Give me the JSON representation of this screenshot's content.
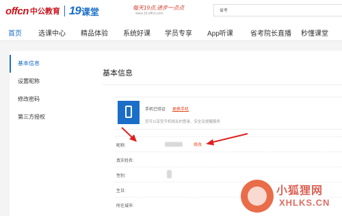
{
  "header": {
    "logo_offcn": "offcn",
    "logo_cn": "中公教育",
    "logo_19": "19",
    "logo_ke": "课堂",
    "slogan": "每天19点,进步一点点",
    "slogan_url": "www.19.offcn.com",
    "search_text": "省考"
  },
  "nav": {
    "items": [
      {
        "label": "首页",
        "active": true
      },
      {
        "label": "选课中心"
      },
      {
        "label": "精品体验"
      },
      {
        "label": "系统好课"
      },
      {
        "label": "学员专享"
      },
      {
        "label": "App听课"
      },
      {
        "label": "省考院长直播"
      },
      {
        "label": "秒懂课堂"
      }
    ]
  },
  "sidebar": {
    "items": [
      {
        "label": "基本信息",
        "active": true
      },
      {
        "label": "设置昵称"
      },
      {
        "label": "修改密码"
      },
      {
        "label": "第三方授权"
      }
    ]
  },
  "content": {
    "title": "基本信息",
    "phone": {
      "verified": "手机已验证",
      "change": "更换手机",
      "description": "您可以享受手机相关的登录、安全及提醒服务"
    },
    "fields": [
      {
        "label": "昵称:",
        "edit": "修改"
      },
      {
        "label": "真实姓名:"
      },
      {
        "label": "性别:"
      },
      {
        "label": "生日:"
      },
      {
        "label": "所在城市:"
      }
    ]
  },
  "watermark": {
    "cn": "小狐狸网",
    "en": "XHLKS.CN"
  },
  "colors": {
    "accent": "#1a6ec8",
    "brand_red": "#c8161d",
    "link_orange": "#e8491d",
    "annotation_red": "#e02020"
  }
}
